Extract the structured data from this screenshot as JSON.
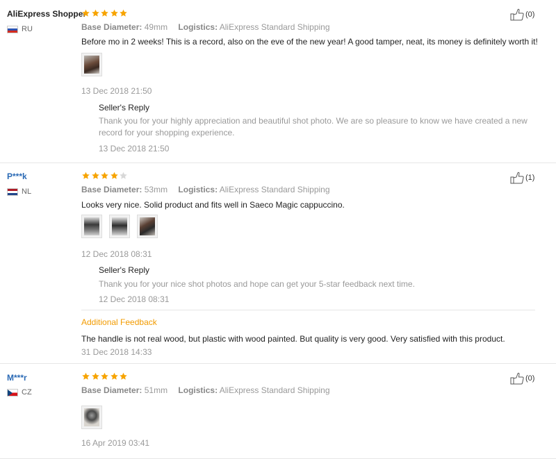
{
  "colors": {
    "star_on": "#f7a400",
    "star_off": "#d8d8d8",
    "link_blue": "#2b6ab5",
    "additional_orange": "#f29b00"
  },
  "icons": {
    "star": "star-icon",
    "thumbs_up": "thumbs-up-icon"
  },
  "reviews": [
    {
      "user": "AliExpress Shopper",
      "country": "RU",
      "rating": 5,
      "base_diameter_label": "Base Diameter:",
      "base_diameter_value": "49mm",
      "logistics_label": "Logistics:",
      "logistics_value": "AliExpress Standard Shipping",
      "content": "Before mo in 2 weeks! This is a record, also on the eve of the new year! A good tamper, neat, its money is definitely worth it!",
      "photos": 1,
      "date": "13 Dec 2018 21:50",
      "helpful": "(0)",
      "reply": {
        "title": "Seller's Reply",
        "text": "Thank you for your highly appreciation and beautiful shot photo. We are so pleasure to know we have created a new record for your shopping experience.",
        "date": "13 Dec 2018 21:50"
      }
    },
    {
      "user": "P***k",
      "country": "NL",
      "rating": 4,
      "base_diameter_label": "Base Diameter:",
      "base_diameter_value": "53mm",
      "logistics_label": "Logistics:",
      "logistics_value": "AliExpress Standard Shipping",
      "content": "Looks very nice. Solid product and fits well in Saeco Magic cappuccino.",
      "photos": 3,
      "date": "12 Dec 2018 08:31",
      "helpful": "(1)",
      "reply": {
        "title": "Seller's Reply",
        "text": "Thank you for your nice shot photos and hope can get your 5-star feedback next time.",
        "date": "12 Dec 2018 08:31"
      },
      "additional": {
        "title": "Additional Feedback",
        "text": "The handle is not real wood, but plastic with wood painted. But quality is very good. Very satisfied with this product.",
        "date": "31 Dec 2018 14:33"
      }
    },
    {
      "user": "M***r",
      "country": "CZ",
      "rating": 5,
      "base_diameter_label": "Base Diameter:",
      "base_diameter_value": "51mm",
      "logistics_label": "Logistics:",
      "logistics_value": "AliExpress Standard Shipping",
      "photos": 1,
      "date": "16 Apr 2019 03:41",
      "helpful": "(0)"
    }
  ]
}
